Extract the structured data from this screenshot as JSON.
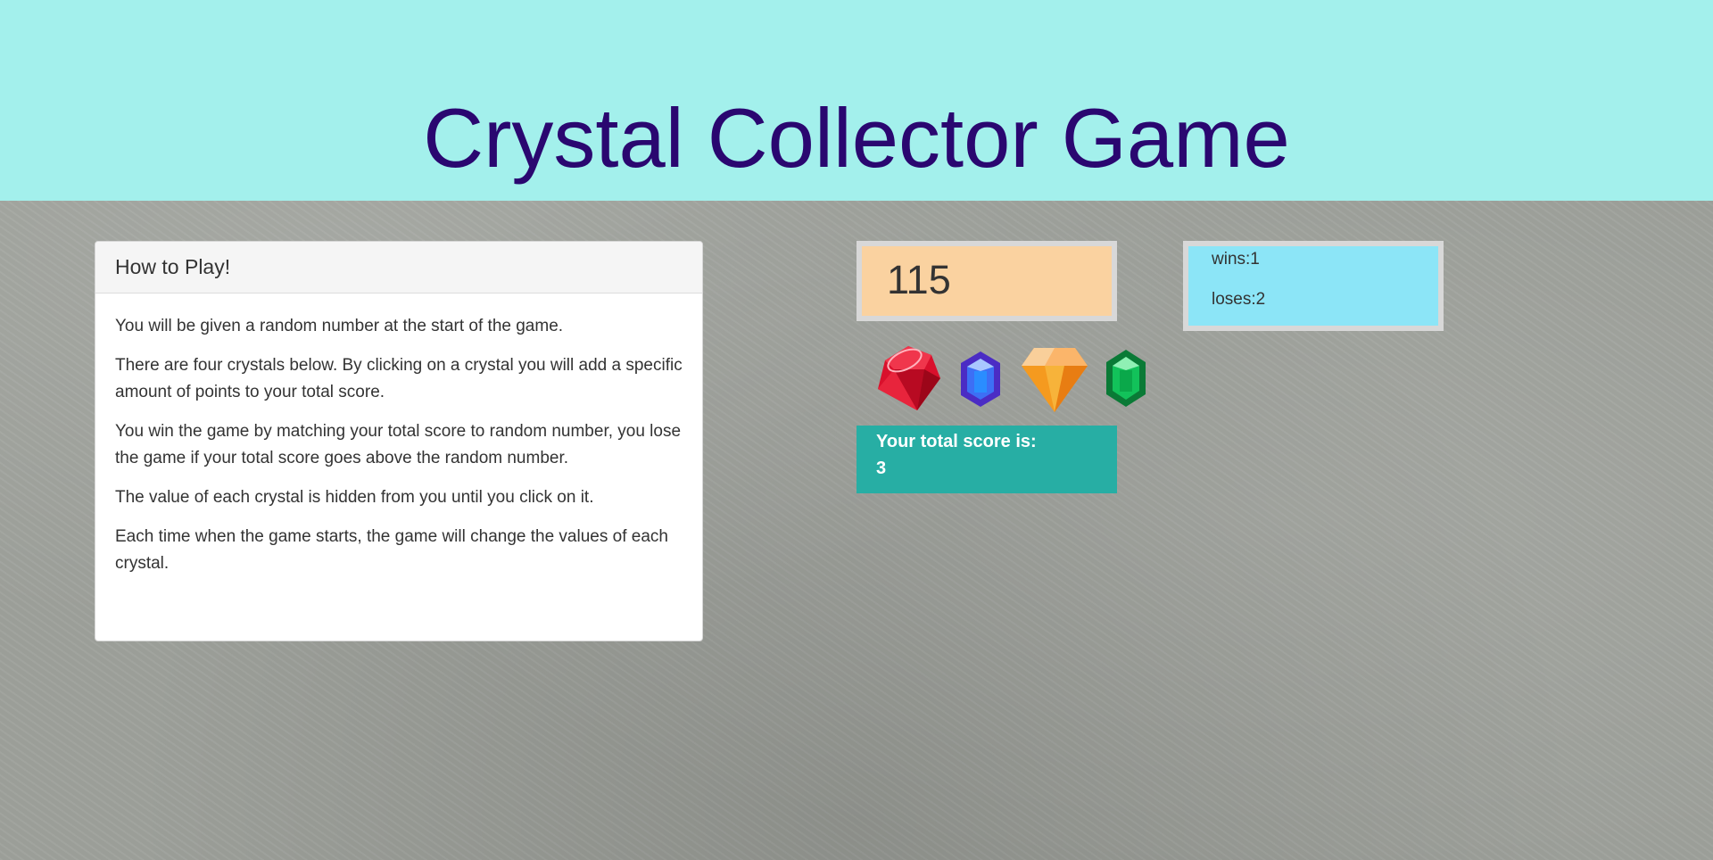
{
  "header": {
    "title": "Crystal Collector Game"
  },
  "instructions": {
    "heading": "How to Play!",
    "paragraphs": [
      "You will be given a random number at the start of the game.",
      "There are four crystals below. By clicking on a crystal you will add a specific amount of points to your total score.",
      "You win the game by matching your total score to random number, you lose the game if your total score goes above the random number.",
      "The value of each crystal is hidden from you until you click on it.",
      "Each time when the game starts, the game will change the values of each crystal."
    ]
  },
  "game": {
    "target_number": "115",
    "wins_text": "wins:1",
    "loses_text": "loses:2",
    "score_label": "Your total score is:",
    "score_value": "3",
    "crystals": [
      {
        "name": "red-ruby",
        "color": "#e0142f"
      },
      {
        "name": "blue-sapphire",
        "color": "#3b3bf0"
      },
      {
        "name": "orange-diamond",
        "color": "#f59a1f"
      },
      {
        "name": "green-emerald",
        "color": "#0ca84a"
      }
    ]
  },
  "colors": {
    "header_bg": "#a3f0ec",
    "title": "#2a0770",
    "target_bg": "#fad2a0",
    "stats_bg": "#8ce5f7",
    "score_bg": "#27aea4"
  }
}
